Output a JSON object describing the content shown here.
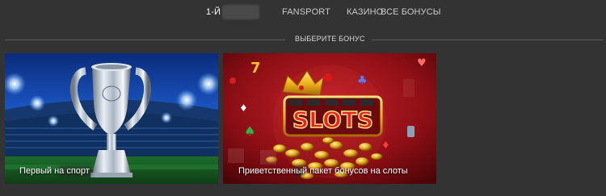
{
  "nav": {
    "tabs": [
      {
        "label": "1-Й",
        "active": true
      },
      {
        "label": "FANSPORT",
        "active": false
      },
      {
        "label": "КАЗИНО",
        "active": false
      },
      {
        "label": "ВСЕ БОНУСЫ",
        "active": false
      }
    ]
  },
  "section": {
    "title": "ВЫБЕРИТЕ БОНУС"
  },
  "cards": [
    {
      "caption": "Первый            на спорт",
      "image": "champions-league-trophy-stadium"
    },
    {
      "caption": "Приветственный пакет бонусов на слоты",
      "image": "slots-crown-coins",
      "image_text": "SLOTS"
    }
  ],
  "colors": {
    "background": "#333333",
    "divider": "#5b5b5b",
    "slots_red": "#8d0f15",
    "slots_gold": "#f2b51d"
  }
}
